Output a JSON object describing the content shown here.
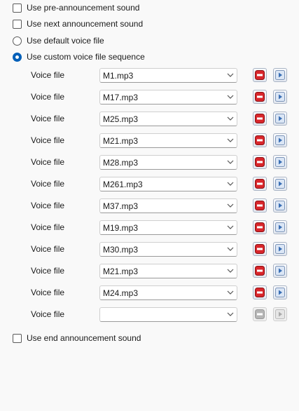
{
  "options": {
    "pre_announcement": {
      "label": "Use pre-announcement sound",
      "checked": false
    },
    "next_announcement": {
      "label": "Use next announcement sound",
      "checked": false
    },
    "default_voice": {
      "label": "Use default voice file",
      "selected": false
    },
    "custom_sequence": {
      "label": "Use custom voice file sequence",
      "selected": true
    },
    "end_announcement": {
      "label": "Use end announcement sound",
      "checked": false
    }
  },
  "voice_rows": [
    {
      "label": "Voice file",
      "value": "M1.mp3",
      "enabled": true
    },
    {
      "label": "Voice file",
      "value": "M17.mp3",
      "enabled": true
    },
    {
      "label": "Voice file",
      "value": "M25.mp3",
      "enabled": true
    },
    {
      "label": "Voice file",
      "value": "M21.mp3",
      "enabled": true
    },
    {
      "label": "Voice file",
      "value": "M28.mp3",
      "enabled": true
    },
    {
      "label": "Voice file",
      "value": "M261.mp3",
      "enabled": true
    },
    {
      "label": "Voice file",
      "value": "M37.mp3",
      "enabled": true
    },
    {
      "label": "Voice file",
      "value": "M19.mp3",
      "enabled": true
    },
    {
      "label": "Voice file",
      "value": "M30.mp3",
      "enabled": true
    },
    {
      "label": "Voice file",
      "value": "M21.mp3",
      "enabled": true
    },
    {
      "label": "Voice file",
      "value": "M24.mp3",
      "enabled": true
    },
    {
      "label": "Voice file",
      "value": "",
      "enabled": false
    }
  ],
  "icons": {
    "remove": "remove-icon",
    "next": "play-next-icon",
    "dropdown": "chevron-down-icon"
  },
  "colors": {
    "accent": "#005fb8",
    "remove_red": "#d9262b",
    "next_blue": "#3a6fb5"
  }
}
